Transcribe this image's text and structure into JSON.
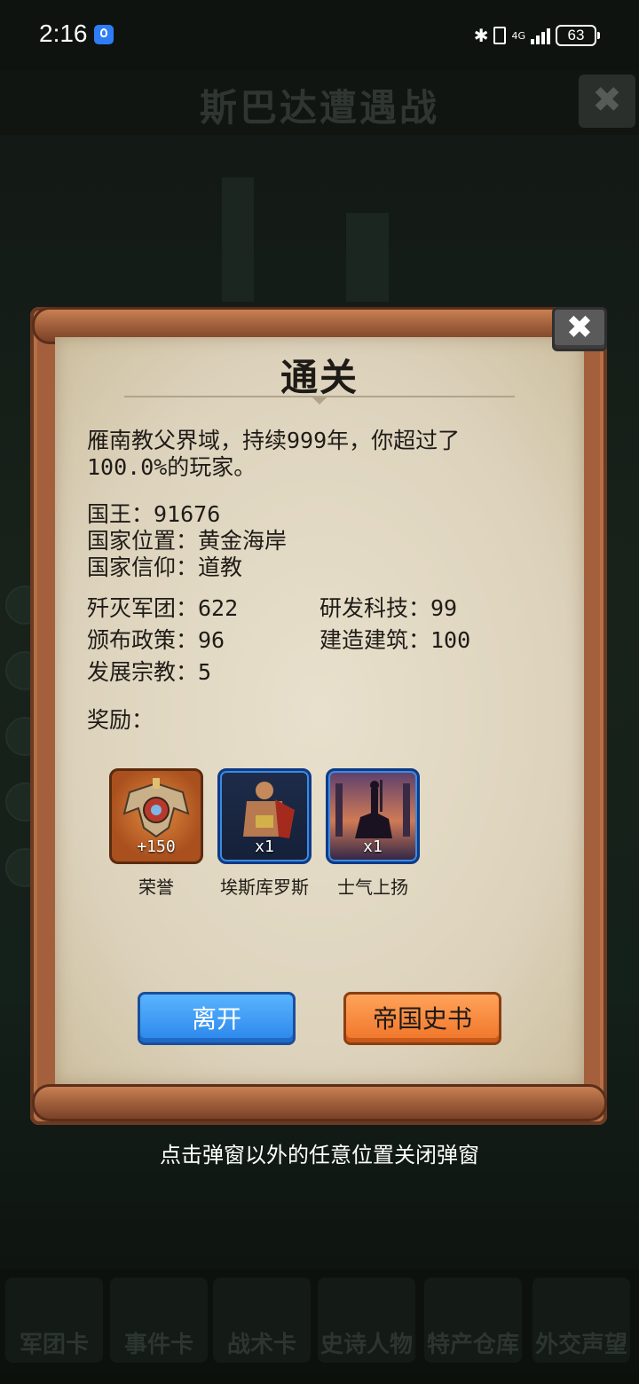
{
  "status_bar": {
    "time": "2:16",
    "network": "4G",
    "battery": "63"
  },
  "background": {
    "title": "斯巴达遭遇战",
    "close_glyph": "✖",
    "bottom_tabs": [
      "军团卡",
      "事件卡",
      "战术卡",
      "史诗人物",
      "特产仓库",
      "外交声望"
    ]
  },
  "dialog": {
    "title": "通关",
    "close_glyph": "✖",
    "summary": "雁南教父界域，持续999年，你超过了100.0%的玩家。",
    "king": "国王：91676",
    "location": "国家位置：黄金海岸",
    "faith": "国家信仰：道教",
    "stats": {
      "legions_destroyed": "歼灭军团：622",
      "tech_researched": "研发科技：99",
      "policies": "颁布政策：96",
      "buildings": "建造建筑：100",
      "religions": "发展宗教：5"
    },
    "rewards_label": "奖励：",
    "rewards": [
      {
        "name": "荣誉",
        "count": "+150",
        "icon": "honor-medal-icon"
      },
      {
        "name": "埃斯库罗斯",
        "count": "x1",
        "icon": "hero-portrait-icon"
      },
      {
        "name": "士气上扬",
        "count": "x1",
        "icon": "morale-card-icon"
      }
    ],
    "leave_button": "离开",
    "history_button": "帝国史书",
    "hint": "点击弹窗以外的任意位置关闭弹窗"
  },
  "colors": {
    "leave": "#2a86ea",
    "history": "#f07428",
    "parchment": "#ddd3bd",
    "frame": "#a4603c"
  }
}
